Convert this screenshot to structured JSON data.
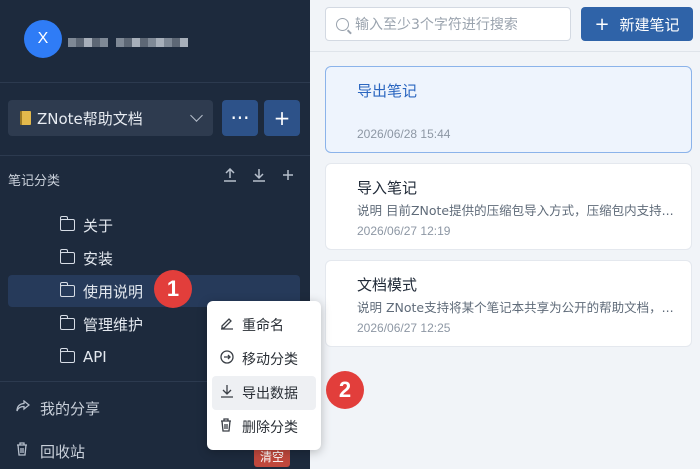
{
  "user": {
    "avatar_letter": "X"
  },
  "notebook": {
    "name": "ZNote帮助文档"
  },
  "sidebar": {
    "more_label": "···",
    "add_label": "+",
    "section_title": "笔记分类",
    "categories": [
      {
        "label": "关于"
      },
      {
        "label": "安装"
      },
      {
        "label": "使用说明"
      },
      {
        "label": "管理维护"
      },
      {
        "label": "API"
      }
    ],
    "share_label": "我的分享",
    "trash_label": "回收站",
    "trash_badge": "清空"
  },
  "search": {
    "placeholder": "输入至少3个字符进行搜索"
  },
  "new_note_label": "新建笔记",
  "notes": [
    {
      "title": "导出笔记",
      "desc": "",
      "date": "2026/06/28 15:44"
    },
    {
      "title": "导入笔记",
      "desc": "说明 目前ZNote提供的压缩包导入方式，压缩包内支持...",
      "date": "2026/06/27 12:19"
    },
    {
      "title": "文档模式",
      "desc": "说明 ZNote支持将某个笔记本共享为公开的帮助文档，...",
      "date": "2026/06/27 12:25"
    }
  ],
  "context_menu": {
    "items": [
      {
        "label": "重命名",
        "icon": "edit-icon"
      },
      {
        "label": "移动分类",
        "icon": "move-icon"
      },
      {
        "label": "导出数据",
        "icon": "download-icon"
      },
      {
        "label": "删除分类",
        "icon": "trash-icon"
      }
    ]
  },
  "annotations": {
    "step1": "1",
    "step2": "2"
  },
  "colors": {
    "sidebar_bg": "#1d2a3d",
    "primary": "#2f63a8",
    "badge_red": "#e23e3b"
  }
}
